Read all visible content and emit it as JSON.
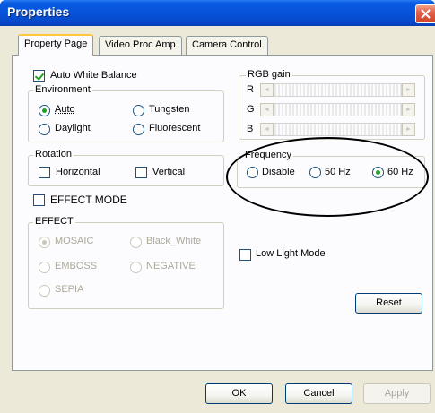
{
  "window": {
    "title": "Properties"
  },
  "tabs": [
    {
      "label": "Property Page",
      "active": true
    },
    {
      "label": "Video Proc Amp",
      "active": false
    },
    {
      "label": "Camera Control",
      "active": false
    }
  ],
  "awb": {
    "label": "Auto White Balance",
    "checked": true
  },
  "environment": {
    "legend": "Environment",
    "options": [
      "Auto",
      "Tungsten",
      "Daylight",
      "Fluorescent"
    ],
    "selected": "Auto"
  },
  "rgb_gain": {
    "legend": "RGB gain",
    "channels": [
      "R",
      "G",
      "B"
    ],
    "left_arrow": "◄",
    "right_arrow": "►"
  },
  "rotation": {
    "legend": "Rotation",
    "options": [
      "Horizontal",
      "Vertical"
    ]
  },
  "frequency": {
    "legend": "Frequency",
    "options": [
      "Disable",
      "50 Hz",
      "60 Hz"
    ],
    "selected": "60 Hz"
  },
  "effect_mode": {
    "label": "EFFECT MODE",
    "checked": false
  },
  "effect": {
    "legend": "EFFECT",
    "options": [
      "MOSAIC",
      "Black_White",
      "EMBOSS",
      "NEGATIVE",
      "SEPIA"
    ],
    "selected": "MOSAIC"
  },
  "low_light": {
    "label": "Low Light Mode",
    "checked": false
  },
  "buttons": {
    "reset": "Reset",
    "ok": "OK",
    "cancel": "Cancel",
    "apply": "Apply"
  },
  "colors": {
    "titlebar": "#0553d8",
    "face": "#ece9d8",
    "check_green": "#21a121"
  }
}
